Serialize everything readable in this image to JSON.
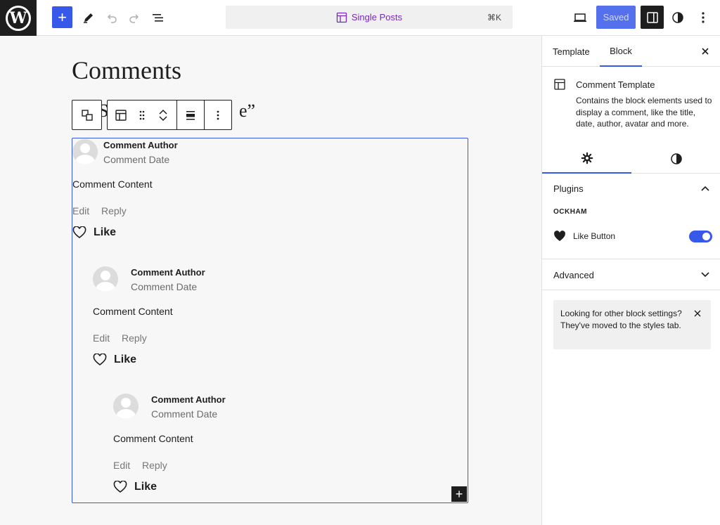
{
  "topbar": {
    "site_logo_text": "W",
    "add_label": "+",
    "document": {
      "title": "Single Posts",
      "shortcut": "⌘K"
    },
    "saved_label": "Saved",
    "icons": [
      "wordpress-logo",
      "plus-icon",
      "pencil-icon",
      "undo-icon",
      "redo-icon",
      "list-view-icon",
      "template-icon",
      "desktop-preview-icon",
      "sidebar-toggle-icon",
      "half-circle-styles-icon",
      "more-vertical-icon"
    ]
  },
  "canvas": {
    "heading": "Comments",
    "title_behind_left": "S",
    "title_behind_right": "e”",
    "inserter_label": "+",
    "comments": [
      {
        "author": "Comment Author",
        "date": "Comment Date",
        "content": "Comment Content",
        "edit": "Edit",
        "reply": "Reply",
        "like": "Like"
      },
      {
        "author": "Comment Author",
        "date": "Comment Date",
        "content": "Comment Content",
        "edit": "Edit",
        "reply": "Reply",
        "like": "Like"
      },
      {
        "author": "Comment Author",
        "date": "Comment Date",
        "content": "Comment Content",
        "edit": "Edit",
        "reply": "Reply",
        "like": "Like"
      }
    ]
  },
  "sidebar": {
    "tabs": [
      "Template",
      "Block"
    ],
    "active_tab": "Block",
    "block": {
      "title": "Comment Template",
      "description": "Contains the block elements used to display a comment, like the title, date, author, avatar and more."
    },
    "subtabs": [
      "settings",
      "styles"
    ],
    "plugins": {
      "title": "Plugins",
      "expanded": true,
      "section_label": "OCKHAM",
      "items": [
        {
          "label": "Like Button",
          "enabled": true
        }
      ]
    },
    "advanced": {
      "title": "Advanced",
      "expanded": false
    },
    "notice": "Looking for other block settings? They've moved to the styles tab."
  },
  "colors": {
    "accent": "#3858e9",
    "template_purple": "#7a28c4",
    "dark": "#1e1e1e",
    "canvas_bg": "#f7f7f7"
  }
}
